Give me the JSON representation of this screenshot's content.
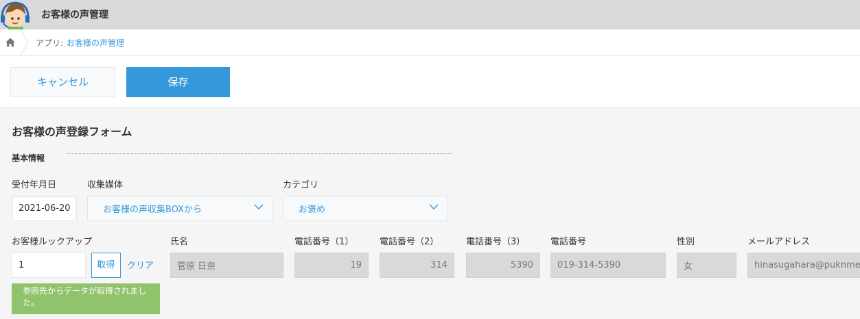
{
  "header": {
    "app_title": "お客様の声管理"
  },
  "breadcrumb": {
    "prefix": "アプリ: ",
    "app_link": "お客様の声管理"
  },
  "toolbar": {
    "cancel_label": "キャンセル",
    "save_label": "保存"
  },
  "form": {
    "title": "お客様の声登録フォーム",
    "section_basic": "基本情報",
    "fields": {
      "receipt_date": {
        "label": "受付年月日",
        "value": "2021-06-20"
      },
      "collection_medium": {
        "label": "収集媒体",
        "value": "お客様の声収集BOXから"
      },
      "category": {
        "label": "カテゴリ",
        "value": "お褒め"
      },
      "customer_lookup": {
        "label": "お客様ルックアップ",
        "value": "1",
        "get_label": "取得",
        "clear_label": "クリア"
      },
      "name": {
        "label": "氏名",
        "value": "菅原 日奈"
      },
      "phone1": {
        "label": "電話番号（1）",
        "value": "19"
      },
      "phone2": {
        "label": "電話番号（2）",
        "value": "314"
      },
      "phone3": {
        "label": "電話番号（3）",
        "value": "5390"
      },
      "phone": {
        "label": "電話番号",
        "value": "019-314-5390"
      },
      "gender": {
        "label": "性別",
        "value": "女"
      },
      "email": {
        "label": "メールアドレス",
        "value": "hinasugahara@puknme"
      }
    },
    "lookup_notice": "参照先からデータが取得されました。"
  },
  "colors": {
    "accent": "#3498db",
    "header_bg": "#d8dadb",
    "notice_bg": "#91c36c",
    "readonly_bg": "#d7d9da"
  },
  "icons": [
    "avatar-icon",
    "home-icon",
    "chevron-down-icon"
  ]
}
